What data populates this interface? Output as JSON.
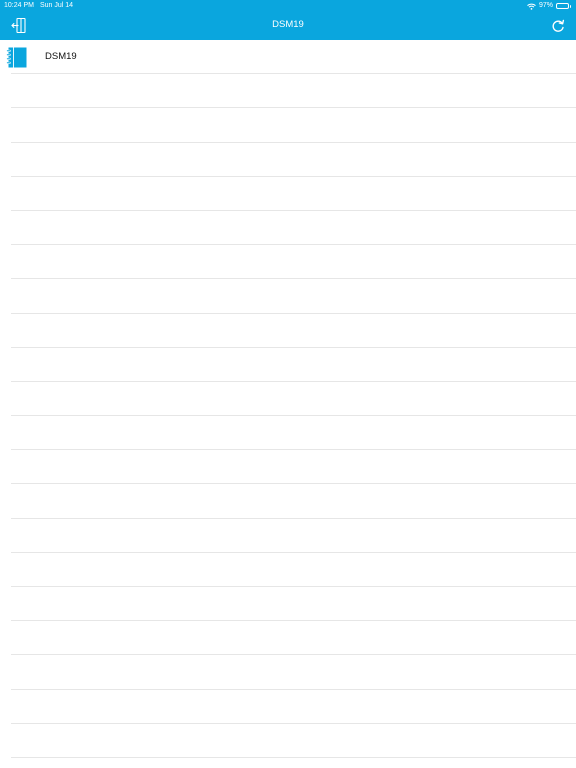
{
  "status_bar": {
    "time": "10:24 PM",
    "date": "Sun Jul 14",
    "battery_percent": "97%",
    "battery_level": 0.97
  },
  "header": {
    "title": "DSM19",
    "left_icon": "logout-icon",
    "right_icon": "refresh-icon"
  },
  "list": {
    "items": [
      {
        "label": "DSM19",
        "icon": "notebook-icon"
      }
    ],
    "empty_row_count": 20
  },
  "colors": {
    "accent": "#0aa6de",
    "background": "#ffffff",
    "separator": "#e6e6e6"
  }
}
